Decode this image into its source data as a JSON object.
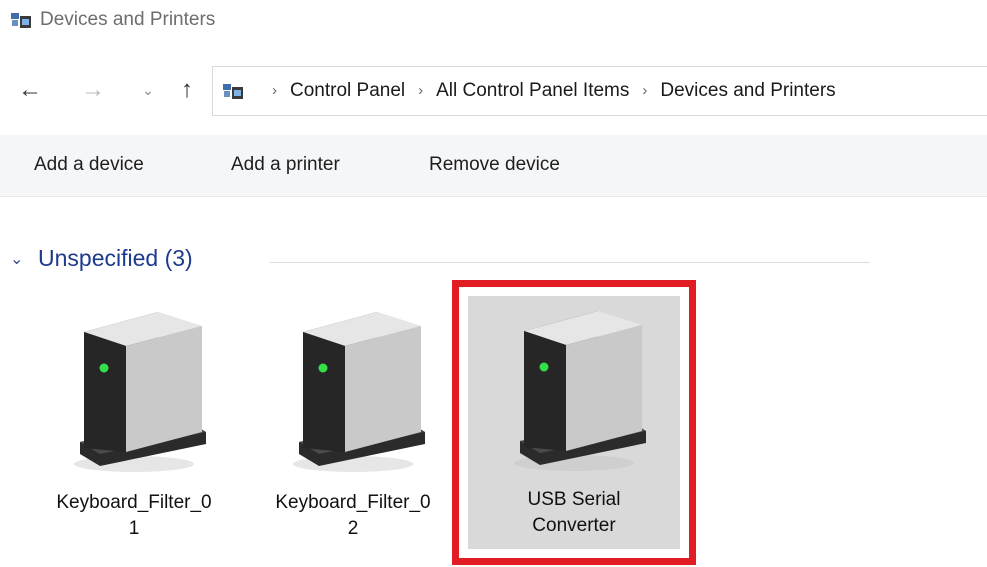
{
  "window": {
    "title": "Devices and Printers"
  },
  "nav": {
    "back_icon": "back-arrow-icon",
    "forward_icon": "forward-arrow-icon",
    "recent_icon": "chevron-down-icon",
    "up_icon": "up-arrow-icon"
  },
  "address": {
    "breadcrumbs": [
      "Control Panel",
      "All Control Panel Items",
      "Devices and Printers"
    ]
  },
  "commands": {
    "add_device": "Add a device",
    "add_printer": "Add a printer",
    "remove_device": "Remove device"
  },
  "group": {
    "label": "Unspecified (3)",
    "devices": [
      {
        "label": "Keyboard_Filter_0\n1",
        "icon": "device-tower-icon",
        "selected": false
      },
      {
        "label": "Keyboard_Filter_0\n2",
        "icon": "device-tower-icon",
        "selected": false
      },
      {
        "label": "USB Serial\nConverter",
        "icon": "device-tower-icon",
        "selected": true
      }
    ]
  },
  "colors": {
    "highlight_border": "#e21c23",
    "selected_background": "#d9d9d9",
    "group_header": "#1e3a8c"
  }
}
